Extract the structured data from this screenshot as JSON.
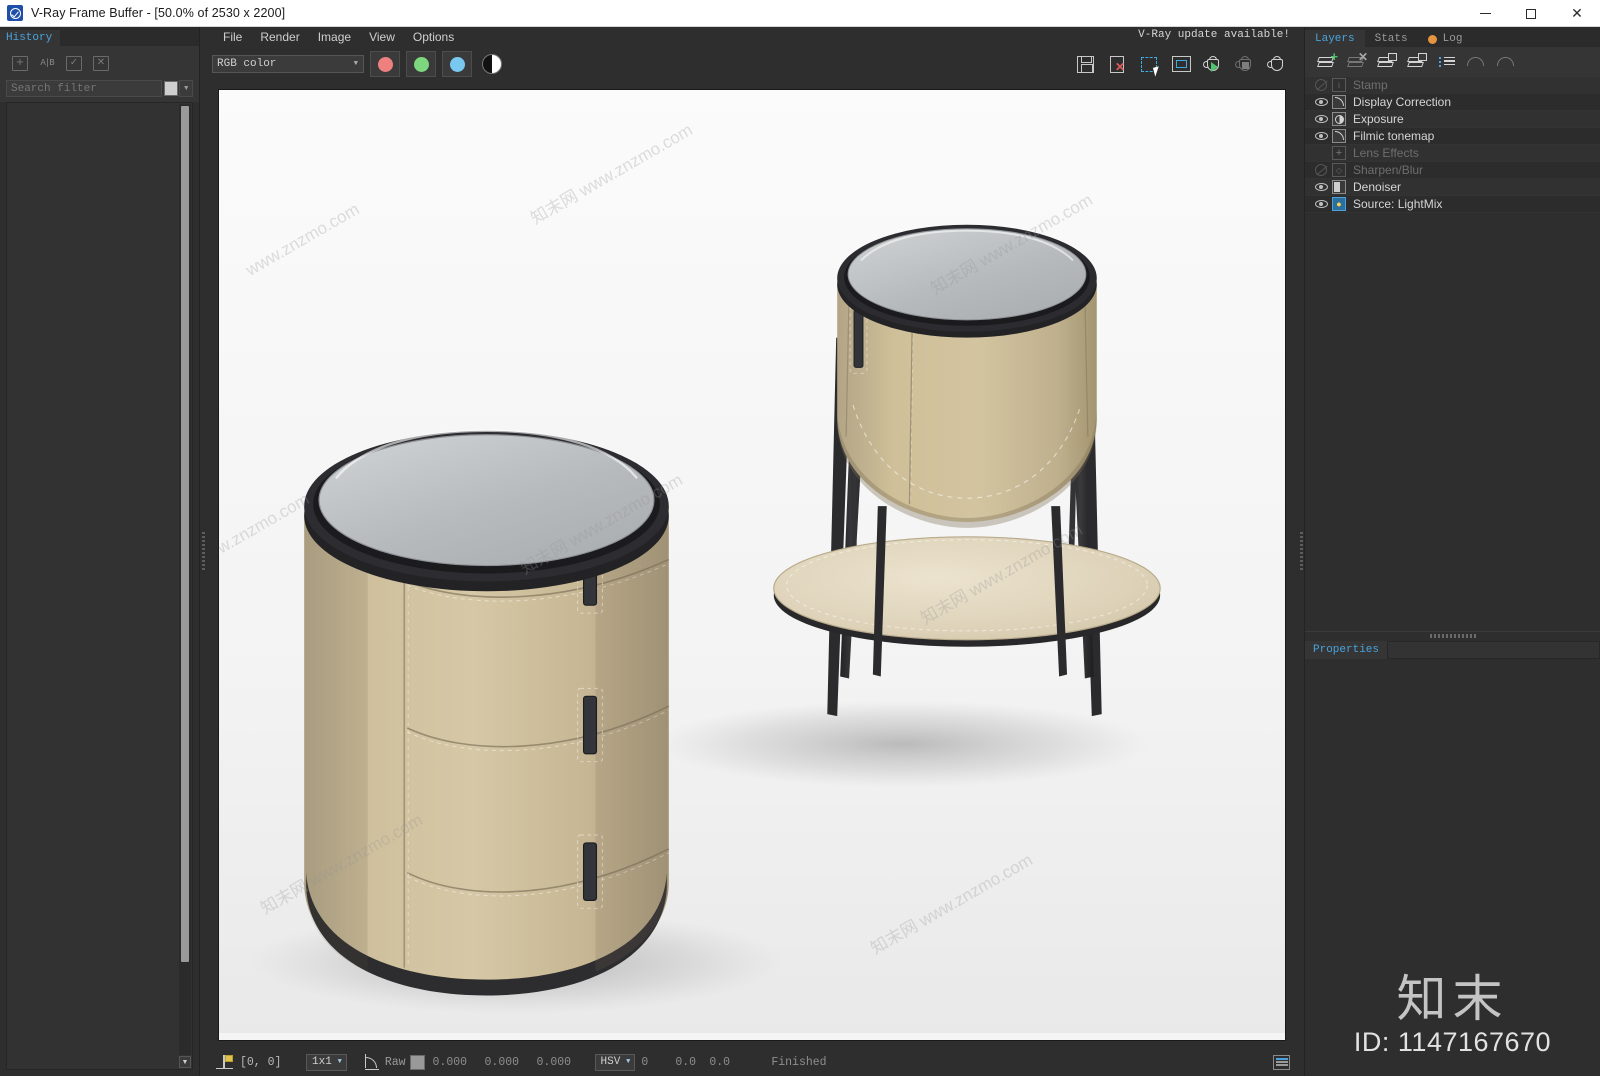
{
  "window": {
    "title": "V-Ray Frame Buffer - [50.0% of 2530 x 2200]",
    "logo_icon": "vray-logo-icon",
    "minimize_label": "–",
    "maximize_label": "□",
    "close_label": "✕"
  },
  "left_panel": {
    "tab_label": "History",
    "toolbar": [
      {
        "name": "history-save-icon",
        "glyph": "+"
      },
      {
        "name": "history-compare-ab-icon",
        "glyph": "A|B"
      },
      {
        "name": "history-load-icon",
        "glyph": "✓"
      },
      {
        "name": "history-delete-icon",
        "glyph": "✕"
      }
    ],
    "search_placeholder": "Search filter",
    "search_value": "",
    "color_swatch": "#cfcfcf",
    "dropdown_caret": "▼",
    "scroll_arrow": "▼"
  },
  "menubar": {
    "items": [
      "File",
      "Render",
      "Image",
      "View",
      "Options"
    ],
    "update_notice": "V-Ray update available!"
  },
  "toolbar": {
    "channel_select_value": "RGB color",
    "channel_caret": "▼",
    "channel_buttons": [
      {
        "name": "red-channel-button",
        "color": "#ef8080"
      },
      {
        "name": "green-channel-button",
        "color": "#7ed67e"
      },
      {
        "name": "blue-channel-button",
        "color": "#79c8ef"
      }
    ],
    "alpha_button": {
      "name": "alpha-channel-button"
    },
    "right_tools": [
      {
        "name": "save-image-icon",
        "label": "Save image"
      },
      {
        "name": "save-all-channels-icon",
        "label": "Save all image channels"
      },
      {
        "name": "region-render-icon",
        "label": "Render region"
      },
      {
        "name": "show-in-window-icon",
        "label": "Show in window"
      },
      {
        "name": "start-render-icon",
        "label": "Start render"
      },
      {
        "name": "stop-render-icon",
        "label": "Stop render"
      },
      {
        "name": "render-last-icon",
        "label": "Render last"
      }
    ]
  },
  "render": {
    "background": "#f2f2f2",
    "zoom": "50.0%",
    "resolution": "2530 x 2200",
    "watermarks": [
      "www.znzmo.com",
      "知末网 www.znzmo.com"
    ],
    "scene": {
      "objects": [
        {
          "name": "round-leather-nightstand",
          "material": "beige leather",
          "top": "dark glass tray top",
          "drawers": 3
        },
        {
          "name": "round-side-table",
          "material": "beige leather band",
          "top": "dark glass tray top",
          "legs": 4,
          "shelf": "lower round shelf"
        }
      ],
      "colors": {
        "leather": "#cdbc97",
        "leather_shadow": "#b5a484",
        "metal": "#2f2f31",
        "glass_top": "#b9bcbe",
        "floor": "#f2f2f2"
      }
    }
  },
  "statusbar": {
    "lock_icon": "lock-pixel-icon",
    "coordinates": "[0, 0]",
    "sample_size": "1x1",
    "sample_caret": "▼",
    "curve_icon": "color-curve-icon",
    "raw_label": "Raw",
    "swatch_color": "#999999",
    "values": [
      "0.000",
      "0.000",
      "0.000"
    ],
    "color_space": "HSV",
    "color_space_caret": "▼",
    "hsv_values": [
      "0",
      "0.0",
      "0.0"
    ],
    "status_text": "Finished",
    "panel_toggle_icon": "toggle-panel-icon"
  },
  "right_panel": {
    "tabs": [
      {
        "label": "Layers",
        "active": true
      },
      {
        "label": "Stats",
        "active": false
      },
      {
        "label": "Log",
        "active": false,
        "dot_color": "#e5953f"
      }
    ],
    "toolbar": [
      {
        "name": "add-layer-icon",
        "enabled": true
      },
      {
        "name": "remove-layer-icon",
        "enabled": false
      },
      {
        "name": "save-layers-icon",
        "enabled": true
      },
      {
        "name": "load-layers-icon",
        "enabled": true
      },
      {
        "name": "layer-presets-icon",
        "enabled": true
      },
      {
        "name": "undo-icon",
        "enabled": false
      },
      {
        "name": "redo-icon",
        "enabled": false
      }
    ],
    "layers": [
      {
        "label": "Stamp",
        "icon": "stamp-icon",
        "visible": false,
        "enabled": false
      },
      {
        "label": "Display Correction",
        "icon": "curve-icon",
        "visible": true,
        "enabled": true
      },
      {
        "label": "Exposure",
        "icon": "exposure-icon",
        "visible": true,
        "enabled": true
      },
      {
        "label": "Filmic tonemap",
        "icon": "filmic-icon",
        "visible": true,
        "enabled": true
      },
      {
        "label": "Lens Effects",
        "icon": "lens-effects-icon",
        "visible": false,
        "enabled": false
      },
      {
        "label": "Sharpen/Blur",
        "icon": "sharpen-blur-icon",
        "visible": false,
        "enabled": false
      },
      {
        "label": "Denoiser",
        "icon": "denoiser-icon",
        "visible": true,
        "enabled": true
      },
      {
        "label": "Source: LightMix",
        "icon": "lightmix-icon",
        "visible": true,
        "enabled": true
      }
    ],
    "properties_tab": "Properties"
  },
  "watermark": {
    "cn_text": "知末",
    "id_text": "ID: 1147167670"
  }
}
